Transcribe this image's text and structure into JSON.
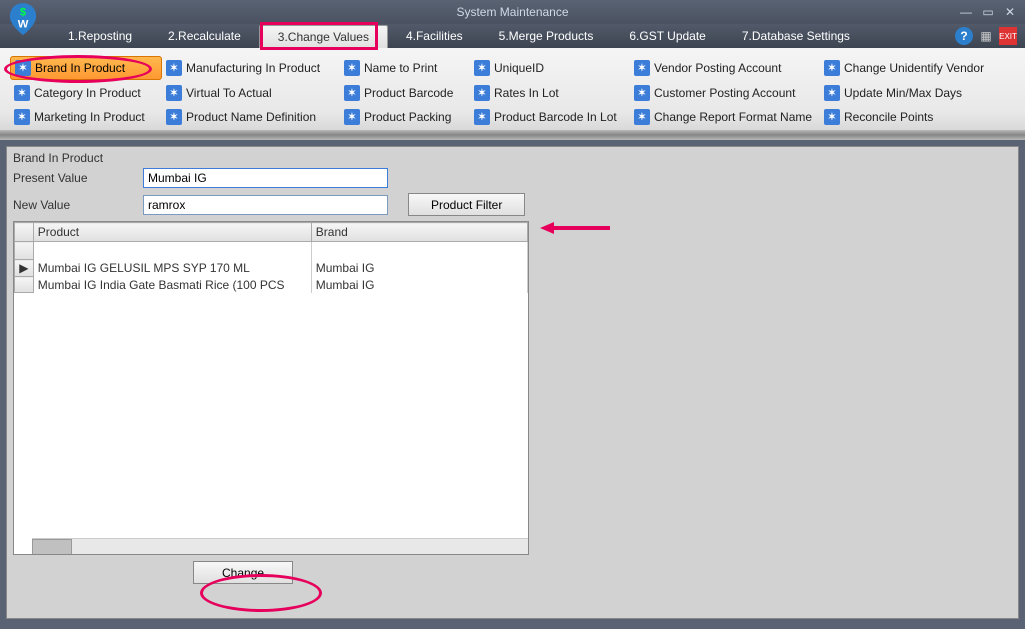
{
  "window": {
    "title": "System Maintenance"
  },
  "menu": {
    "items": [
      "1.Reposting",
      "2.Recalculate",
      "3.Change Values",
      "4.Facilities",
      "5.Merge Products",
      "6.GST Update",
      "7.Database Settings"
    ],
    "active_index": 2
  },
  "ribbon": {
    "rows": [
      [
        "Brand In Product",
        "Manufacturing In Product",
        "Name to Print",
        "UniqueID",
        "Vendor Posting Account",
        "Change Unidentify Vendor"
      ],
      [
        "Category In Product",
        "Virtual To Actual",
        "Product Barcode",
        "Rates In Lot",
        "Customer Posting Account",
        "Update Min/Max Days"
      ],
      [
        "Marketing In Product",
        "Product Name Definition",
        "Product Packing",
        "Product Barcode In Lot",
        "Change Report Format Name",
        "Reconcile Points"
      ]
    ],
    "active": "Brand In Product"
  },
  "form": {
    "section_title": "Brand In Product",
    "present_label": "Present Value",
    "present_value": "Mumbai IG",
    "new_label": "New Value",
    "new_value": "ramrox",
    "filter_btn": "Product Filter",
    "change_btn": "Change"
  },
  "grid": {
    "columns": [
      "Product",
      "Brand"
    ],
    "rows": [
      {
        "product": "Mumbai IG GELUSIL MPS SYP 170 ML",
        "brand": "Mumbai IG",
        "marker": "▶"
      },
      {
        "product": "Mumbai IG India Gate Basmati Rice (100 PCS",
        "brand": "Mumbai IG",
        "marker": ""
      }
    ]
  }
}
